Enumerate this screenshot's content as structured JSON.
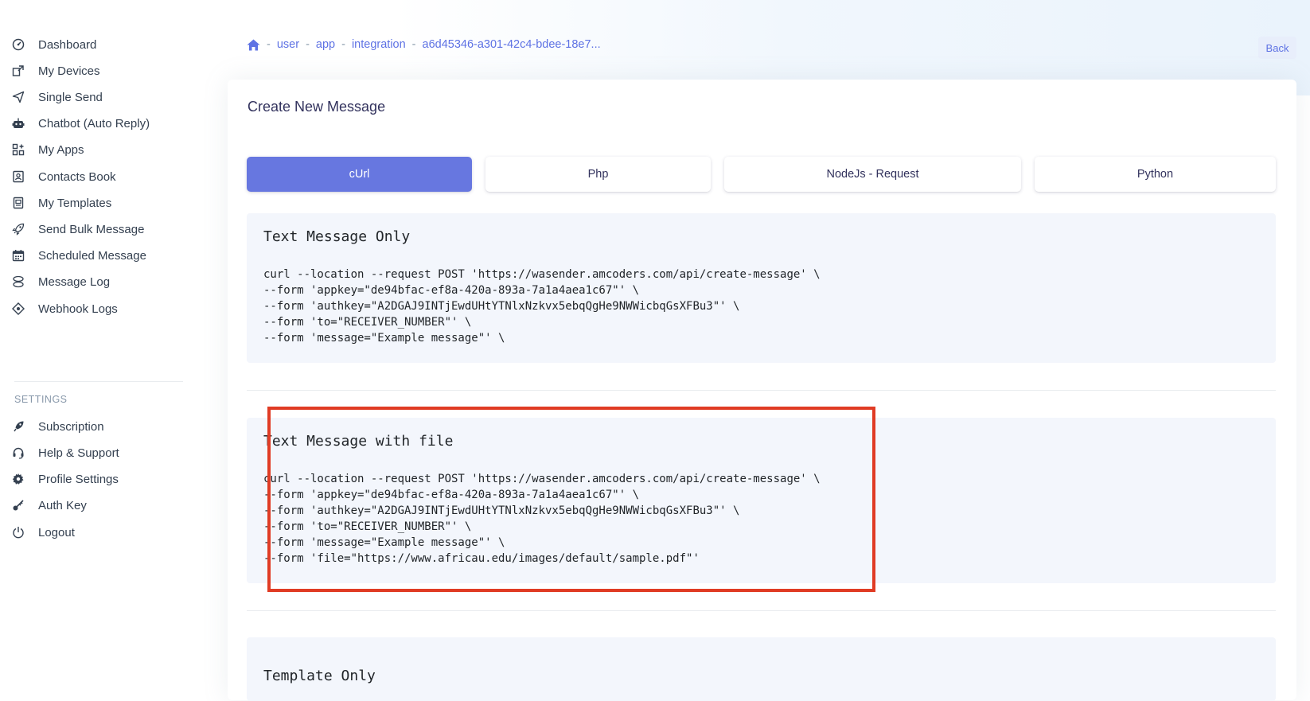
{
  "sidebar": {
    "items": [
      {
        "label": "Dashboard",
        "icon": "dashboard-icon"
      },
      {
        "label": "My Devices",
        "icon": "device-icon"
      },
      {
        "label": "Single Send",
        "icon": "send-icon"
      },
      {
        "label": "Chatbot (Auto Reply)",
        "icon": "robot-icon"
      },
      {
        "label": "My Apps",
        "icon": "apps-icon"
      },
      {
        "label": "Contacts Book",
        "icon": "contacts-icon"
      },
      {
        "label": "My Templates",
        "icon": "template-icon"
      },
      {
        "label": "Send Bulk Message",
        "icon": "rocket-icon"
      },
      {
        "label": "Scheduled Message",
        "icon": "calendar-icon"
      },
      {
        "label": "Message Log",
        "icon": "log-icon"
      },
      {
        "label": "Webhook Logs",
        "icon": "webhook-icon"
      }
    ],
    "settings_label": "SETTINGS",
    "settings_items": [
      {
        "label": "Subscription",
        "icon": "subscription-icon"
      },
      {
        "label": "Help & Support",
        "icon": "headset-icon"
      },
      {
        "label": "Profile Settings",
        "icon": "gear-icon"
      },
      {
        "label": "Auth Key",
        "icon": "key-icon"
      },
      {
        "label": "Logout",
        "icon": "power-icon"
      }
    ]
  },
  "breadcrumb": {
    "home_icon": "home-icon",
    "separator": "-",
    "items": [
      "user",
      "app",
      "integration",
      "a6d45346-a301-42c4-bdee-18e7..."
    ]
  },
  "header": {
    "back_label": "Back"
  },
  "card": {
    "title": "Create New Message",
    "tabs": [
      {
        "label": "cUrl",
        "active": true
      },
      {
        "label": "Php",
        "active": false
      },
      {
        "label": "NodeJs - Request",
        "active": false
      },
      {
        "label": "Python",
        "active": false
      }
    ]
  },
  "examples": [
    {
      "title": "Text Message Only",
      "code": "curl --location --request POST 'https://wasender.amcoders.com/api/create-message' \\\n--form 'appkey=\"de94bfac-ef8a-420a-893a-7a1a4aea1c67\"' \\\n--form 'authkey=\"A2DGAJ9INTjEwdUHtYTNlxNzkvx5ebqQgHe9NWWicbqGsXFBu3\"' \\\n--form 'to=\"RECEIVER_NUMBER\"' \\\n--form 'message=\"Example message\"' \\"
    },
    {
      "title": "Text Message with file",
      "code": "curl --location --request POST 'https://wasender.amcoders.com/api/create-message' \\\n--form 'appkey=\"de94bfac-ef8a-420a-893a-7a1a4aea1c67\"' \\\n--form 'authkey=\"A2DGAJ9INTjEwdUHtYTNlxNzkvx5ebqQgHe9NWWicbqGsXFBu3\"' \\\n--form 'to=\"RECEIVER_NUMBER\"' \\\n--form 'message=\"Example message\"' \\\n--form 'file=\"https://www.africau.edu/images/default/sample.pdf\"'"
    },
    {
      "title": "Template Only",
      "code": ""
    }
  ],
  "colors": {
    "accent": "#6777e0",
    "highlight": "#e03b24",
    "code_bg": "#f3f6fc"
  }
}
